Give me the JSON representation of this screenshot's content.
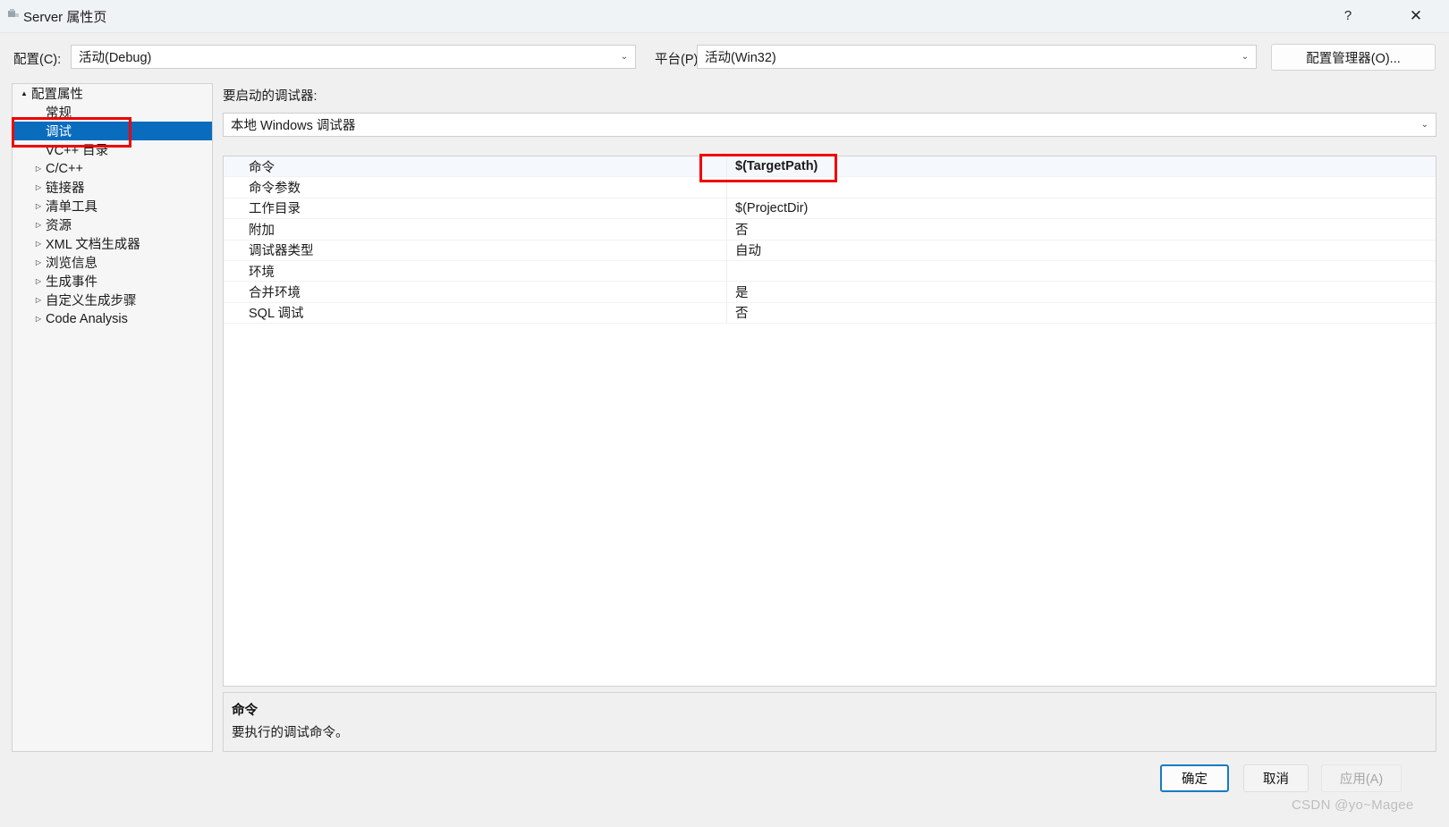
{
  "window": {
    "title": "Server 属性页",
    "icon": "window-properties-icon",
    "help_label": "?",
    "close_label": "✕"
  },
  "config_bar": {
    "configuration_label": "配置(C):",
    "configuration_value": "活动(Debug)",
    "platform_label": "平台(P):",
    "platform_value": "活动(Win32)",
    "config_manager_button": "配置管理器(O)...",
    "chevron": "⌄"
  },
  "tree": {
    "items": [
      {
        "label": "配置属性",
        "level": 0,
        "arrow": "▲",
        "selected": false
      },
      {
        "label": "常规",
        "level": 1,
        "arrow": "",
        "selected": false
      },
      {
        "label": "调试",
        "level": 1,
        "arrow": "",
        "selected": true
      },
      {
        "label": "VC++ 目录",
        "level": 1,
        "arrow": "",
        "selected": false
      },
      {
        "label": "C/C++",
        "level": 1,
        "arrow": "▷",
        "selected": false
      },
      {
        "label": "链接器",
        "level": 1,
        "arrow": "▷",
        "selected": false
      },
      {
        "label": "清单工具",
        "level": 1,
        "arrow": "▷",
        "selected": false
      },
      {
        "label": "资源",
        "level": 1,
        "arrow": "▷",
        "selected": false
      },
      {
        "label": "XML 文档生成器",
        "level": 1,
        "arrow": "▷",
        "selected": false
      },
      {
        "label": "浏览信息",
        "level": 1,
        "arrow": "▷",
        "selected": false
      },
      {
        "label": "生成事件",
        "level": 1,
        "arrow": "▷",
        "selected": false
      },
      {
        "label": "自定义生成步骤",
        "level": 1,
        "arrow": "▷",
        "selected": false
      },
      {
        "label": "Code Analysis",
        "level": 1,
        "arrow": "▷",
        "selected": false
      }
    ]
  },
  "main": {
    "debugger_label": "要启动的调试器:",
    "debugger_value": "本地 Windows 调试器",
    "chevron": "⌄",
    "properties": [
      {
        "name": "命令",
        "value": "$(TargetPath)",
        "selected": true,
        "highlighted": true
      },
      {
        "name": "命令参数",
        "value": "",
        "selected": false,
        "highlighted": false
      },
      {
        "name": "工作目录",
        "value": "$(ProjectDir)",
        "selected": false,
        "highlighted": false
      },
      {
        "name": "附加",
        "value": "否",
        "selected": false,
        "highlighted": false
      },
      {
        "name": "调试器类型",
        "value": "自动",
        "selected": false,
        "highlighted": false
      },
      {
        "name": "环境",
        "value": "",
        "selected": false,
        "highlighted": false
      },
      {
        "name": "合并环境",
        "value": "是",
        "selected": false,
        "highlighted": false
      },
      {
        "name": "SQL 调试",
        "value": "否",
        "selected": false,
        "highlighted": false
      }
    ]
  },
  "description": {
    "title": "命令",
    "text": "要执行的调试命令。"
  },
  "buttons": {
    "ok": "确定",
    "cancel": "取消",
    "apply": "应用(A)"
  },
  "watermark": "CSDN @yo~Magee",
  "colors": {
    "selection_blue": "#0a6cbd",
    "annotation_red": "#ef0000",
    "dialog_bg": "#f0f0f0",
    "titlebar_bg": "#eff3f5",
    "focus_border": "#1a7ac0"
  }
}
